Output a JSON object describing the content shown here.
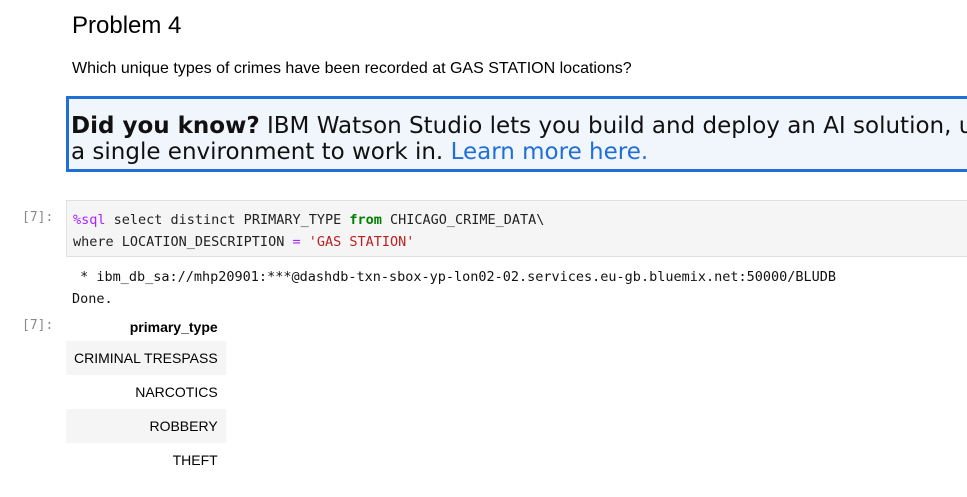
{
  "problem": {
    "title": "Problem 4",
    "question": "Which unique types of crimes have been recorded at GAS STATION locations?"
  },
  "callout": {
    "bold": "Did you know?",
    "text_line1": " IBM Watson Studio lets you build and deploy an AI solution, us",
    "text_line2": "a single environment to work in. ",
    "link": "Learn more here."
  },
  "cell": {
    "in_prompt": "[7]:",
    "code": {
      "magic": "%sql",
      "line1_a": " select distinct PRIMARY_TYPE ",
      "from_kw": "from",
      "line1_b": " CHICAGO_CRIME_DATA\\",
      "line2_a": "where LOCATION_DESCRIPTION ",
      "op": "=",
      "line2_space": " ",
      "string": "'GAS STATION'"
    },
    "stdout": [
      " * ibm_db_sa://mhp20901:***@dashdb-txn-sbox-yp-lon02-02.services.eu-gb.bluemix.net:50000/BLUDB",
      "Done."
    ],
    "out_prompt": "[7]:",
    "result": {
      "column": "primary_type",
      "rows": [
        "CRIMINAL TRESPASS",
        "NARCOTICS",
        "ROBBERY",
        "THEFT"
      ]
    }
  }
}
